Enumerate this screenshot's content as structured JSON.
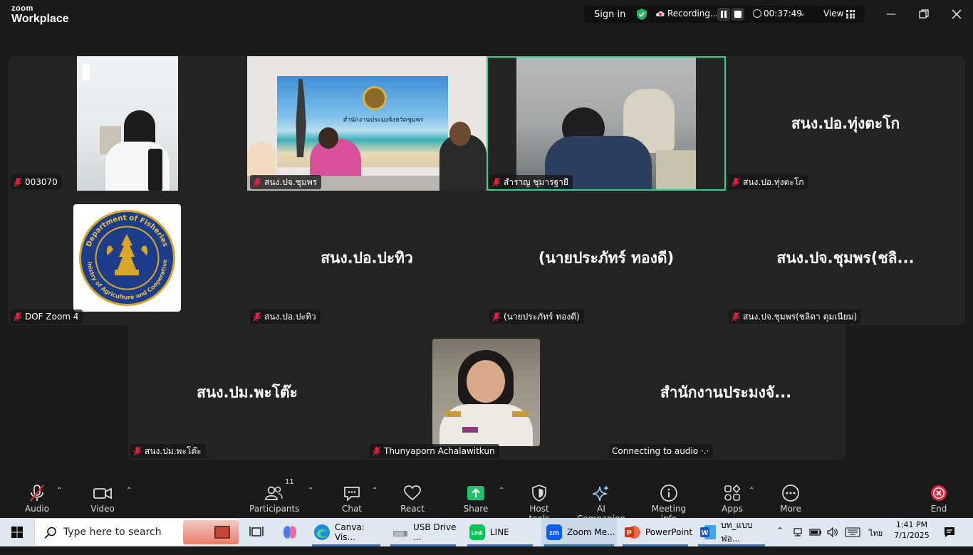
{
  "window": {
    "logo_line1": "zoom",
    "logo_line2": "Workplace",
    "sign_in": "Sign in",
    "recording_label": "Recording...",
    "timer": "00:37:49",
    "view_label": "View"
  },
  "tiles": [
    {
      "name": "003070",
      "muted": true
    },
    {
      "name": "สนง.ปจ.ชุมพร",
      "muted": true
    },
    {
      "name": "สำราญ ชุมารฐายี",
      "muted": true
    },
    {
      "name": "สนง.ปอ.ทุ่งตะโก",
      "display": "สนง.ปอ.ทุ่งตะโก",
      "muted": true
    },
    {
      "name": "DOF Zoom 4",
      "muted": true
    },
    {
      "name": "สนง.ปอ.ปะทิว",
      "display": "สนง.ปอ.ปะทิว",
      "muted": true
    },
    {
      "name": "(นายประภัทร์ ทองดี)",
      "display": "(นายประภัทร์ ทองดี)",
      "muted": true
    },
    {
      "name": "สนง.ปจ.ชุมพร(ชลิดา ตุมเนียม)",
      "display": "สนง.ปจ.ชุมพร(ชลิ...",
      "muted": true
    },
    {
      "name": "สนง.ปม.พะโต๊ะ",
      "display": "สนง.ปม.พะโต๊ะ",
      "muted": true
    },
    {
      "name": "Thunyaporn Achalawitkun",
      "muted": true
    },
    {
      "name": "Connecting to audio ·.·",
      "display": "สำนักงานประมงจั...",
      "muted": false
    }
  ],
  "logo_text": {
    "top": "Department of Fisheries",
    "bottom": "Ministry of Agriculture and Cooperatives"
  },
  "poster_text": "สำนักงานประมงจังหวัดชุมพร",
  "toolbar": {
    "audio": "Audio",
    "video": "Video",
    "participants": "Participants",
    "participants_count": "11",
    "chat": "Chat",
    "react": "React",
    "share": "Share",
    "host_tools": "Host tools",
    "ai_companion": "AI Companion",
    "meeting_info": "Meeting info",
    "apps": "Apps",
    "more": "More",
    "end": "End"
  },
  "taskbar": {
    "search_placeholder": "Type here to search",
    "apps": [
      {
        "label": "Canva: Vis...",
        "icon": "edge-icon"
      },
      {
        "label": "USB Drive ...",
        "icon": "usb-drive-icon"
      },
      {
        "label": "LINE",
        "icon": "line-icon"
      },
      {
        "label": "Zoom Me...",
        "icon": "zoom-icon"
      },
      {
        "label": "PowerPoint",
        "icon": "powerpoint-icon"
      },
      {
        "label": "บท_แบบฟอ...",
        "icon": "word-icon"
      }
    ],
    "language": "ไทย",
    "time": "1:41 PM",
    "date": "7/1/2025"
  },
  "colors": {
    "speaking_border": "#2ed18b",
    "share_green": "#1fc06a",
    "end_red": "#e0243a",
    "mute_red": "#e0243a",
    "tile_bg": "#242424"
  }
}
